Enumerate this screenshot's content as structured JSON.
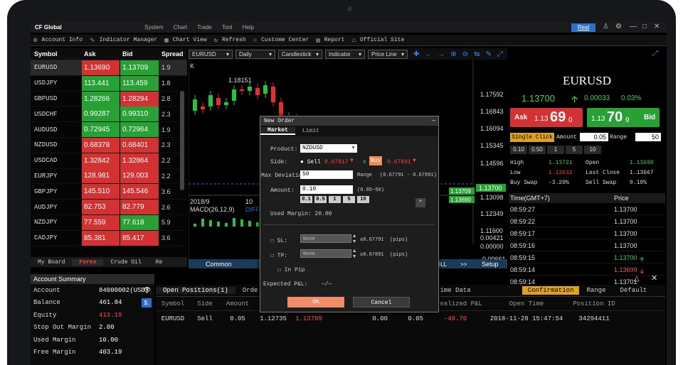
{
  "app": {
    "logo": "CF Global",
    "menu": [
      "System",
      "Chart",
      "Trade",
      "Tool",
      "Help"
    ],
    "account_mode": "Real"
  },
  "toolbar": [
    "Account Info",
    "Indicator Manager",
    "Chart View",
    "Refresh",
    "Custome Center",
    "Report",
    "Official Site"
  ],
  "quotes": {
    "headers": [
      "Symbol",
      "Ask",
      "Bid",
      "Spread"
    ],
    "rows": [
      {
        "sym": "EURUSD",
        "ask": "1.13690",
        "bid": "1.13709",
        "spr": "1.9",
        "ac": "red",
        "bc": "green"
      },
      {
        "sym": "USDJPY",
        "ask": "113.441",
        "bid": "113.459",
        "spr": "1.8",
        "ac": "green",
        "bc": "green"
      },
      {
        "sym": "GBPUSD",
        "ask": "1.28266",
        "bid": "1.28294",
        "spr": "2.8",
        "ac": "green",
        "bc": "red"
      },
      {
        "sym": "USDCHF",
        "ask": "0.99287",
        "bid": "0.99310",
        "spr": "2.3",
        "ac": "green",
        "bc": "green"
      },
      {
        "sym": "AUDUSD",
        "ask": "0.72945",
        "bid": "0.72964",
        "spr": "1.9",
        "ac": "green",
        "bc": "green"
      },
      {
        "sym": "NZDUSD",
        "ask": "0.68378",
        "bid": "0.68401",
        "spr": "2.3",
        "ac": "red",
        "bc": "red"
      },
      {
        "sym": "USDCAD",
        "ask": "1.32842",
        "bid": "1.32864",
        "spr": "2.2",
        "ac": "red",
        "bc": "red"
      },
      {
        "sym": "EURJPY",
        "ask": "128.981",
        "bid": "129.003",
        "spr": "2.2",
        "ac": "red",
        "bc": "red"
      },
      {
        "sym": "GBPJPY",
        "ask": "145.510",
        "bid": "145.546",
        "spr": "3.6",
        "ac": "red",
        "bc": "red"
      },
      {
        "sym": "AUDJPY",
        "ask": "82.753",
        "bid": "82.779",
        "spr": "2.6",
        "ac": "red",
        "bc": "red"
      },
      {
        "sym": "NZDJPY",
        "ask": "77.559",
        "bid": "77.618",
        "spr": "5.9",
        "ac": "red",
        "bc": "green"
      },
      {
        "sym": "CADJPY",
        "ask": "85.381",
        "bid": "85.417",
        "spr": "3.6",
        "ac": "red",
        "bc": "red"
      }
    ],
    "tabs": [
      "My Board",
      "Forex",
      "Crude Oil",
      "Re"
    ]
  },
  "chart": {
    "symbol": "EURUSD",
    "period": "Daily",
    "style": "Candlestick",
    "indicator": "Indicator",
    "price_line": "Price Line",
    "k_label": "K",
    "high_label": "1.18151",
    "date_label": "2018/9",
    "date_label2": "10",
    "macd": "MACD(26,12,9)",
    "diff": "DIFF",
    "levels": [
      "1.17592",
      "1.16843",
      "1.16094",
      "1.15345",
      "1.14596",
      "1.13700",
      "1.13098",
      "1.12349",
      "1.11600",
      "0.00421",
      "0.00000",
      "-0.00661"
    ],
    "tag_ask": "1.13709",
    "tag_bid": "1.13690",
    "bottom": [
      "Common",
      "OLL",
      ">>",
      "Setup"
    ]
  },
  "panel": {
    "symbol": "EURUSD",
    "price": "1.13700",
    "change": "0.00033",
    "pct": "0.03%",
    "ask_label": "Ask",
    "ask_pre": "1.13",
    "ask_big": "69",
    "ask_post": "0",
    "bid_label": "Bid",
    "bid_pre": "1.13",
    "bid_big": "70",
    "bid_post": "9",
    "single_click": "Single Click",
    "amount_label": "Amount",
    "amount": "0.05",
    "range_label": "Range",
    "range": "50",
    "chips": [
      "0.10",
      "0.50",
      "1",
      "5",
      "10"
    ],
    "stats": {
      "high_k": "High",
      "high": "1.13721",
      "open_k": "Open",
      "open": "1.13698",
      "low_k": "Low",
      "low": "1.13632",
      "last_k": "Last Close",
      "last": "1.13667",
      "bs_k": "Buy Swap",
      "bs": "-3.20%",
      "ss_k": "Sell Swap",
      "ss": "0.10%"
    },
    "ticks_head": [
      "Time(GMT+7)",
      "Price"
    ],
    "ticks": [
      [
        "08:59:27",
        "1.13700",
        ""
      ],
      [
        "08:59:22",
        "1.13700",
        ""
      ],
      [
        "08:59:17",
        "1.13700",
        ""
      ],
      [
        "08:59:16",
        "1.13700",
        ""
      ],
      [
        "08:59:15",
        "1.13700",
        "up"
      ],
      [
        "08:59:14",
        "1.13699",
        "down"
      ],
      [
        "08:59:14",
        "1.13701",
        ""
      ]
    ]
  },
  "account": {
    "title": "Account Summary",
    "rows": [
      [
        "Account",
        "84000002(USD)"
      ],
      [
        "Balance",
        "461.84"
      ],
      [
        "Equity",
        "413.19"
      ],
      [
        "Stop Out Margin",
        "2.00"
      ],
      [
        "Used Margin",
        "10.00"
      ],
      [
        "Free Margin",
        "403.19"
      ]
    ]
  },
  "positions": {
    "tabs": [
      "Open Positions(1)",
      "Orde",
      "ime Data"
    ],
    "right_tabs": [
      "Confirmation",
      "Range",
      "Default"
    ],
    "headers": [
      "Symbol",
      "Side",
      "Amount",
      "",
      "",
      "",
      "Unrealized P&L",
      "Open Time",
      "Position ID"
    ],
    "row": [
      "EURUSD",
      "Sell",
      "0.05",
      "1.12735",
      "1.13709",
      "0.00",
      "0.05",
      "-48.70",
      "2018-11-28 15:47:54",
      "34294411"
    ]
  },
  "order": {
    "title": "New Order",
    "tabs": [
      "Market",
      "Limit"
    ],
    "product_label": "Product:",
    "product": "NZDUSD",
    "side_label": "Side:",
    "sell": "Sell",
    "sell_price": "0.67817",
    "buy": "Buy",
    "buy_price": "0.67841",
    "dev_label": "Max Deviation",
    "dev": "50",
    "range_label": "Range",
    "range": "(0.67791 - 0.67891)",
    "amount_label": "Amount:",
    "amount": "0.10",
    "amount_range": "(0.05~50)",
    "qs": [
      "0.1",
      "0.5",
      "1",
      "5",
      "10"
    ],
    "used_margin": "Used Margin: 20.00",
    "sl_label": "SL:",
    "sl_ph": "None",
    "sl_hint": "≤0.67791",
    "tp_label": "TP:",
    "tp_ph": "None",
    "tp_hint": "≥0.67891",
    "pips": "(pips)",
    "in_pip": "In Pip",
    "pl_label": "Expected P&L:",
    "pl": "—/—",
    "ok": "OK",
    "cancel": "Cancel"
  }
}
